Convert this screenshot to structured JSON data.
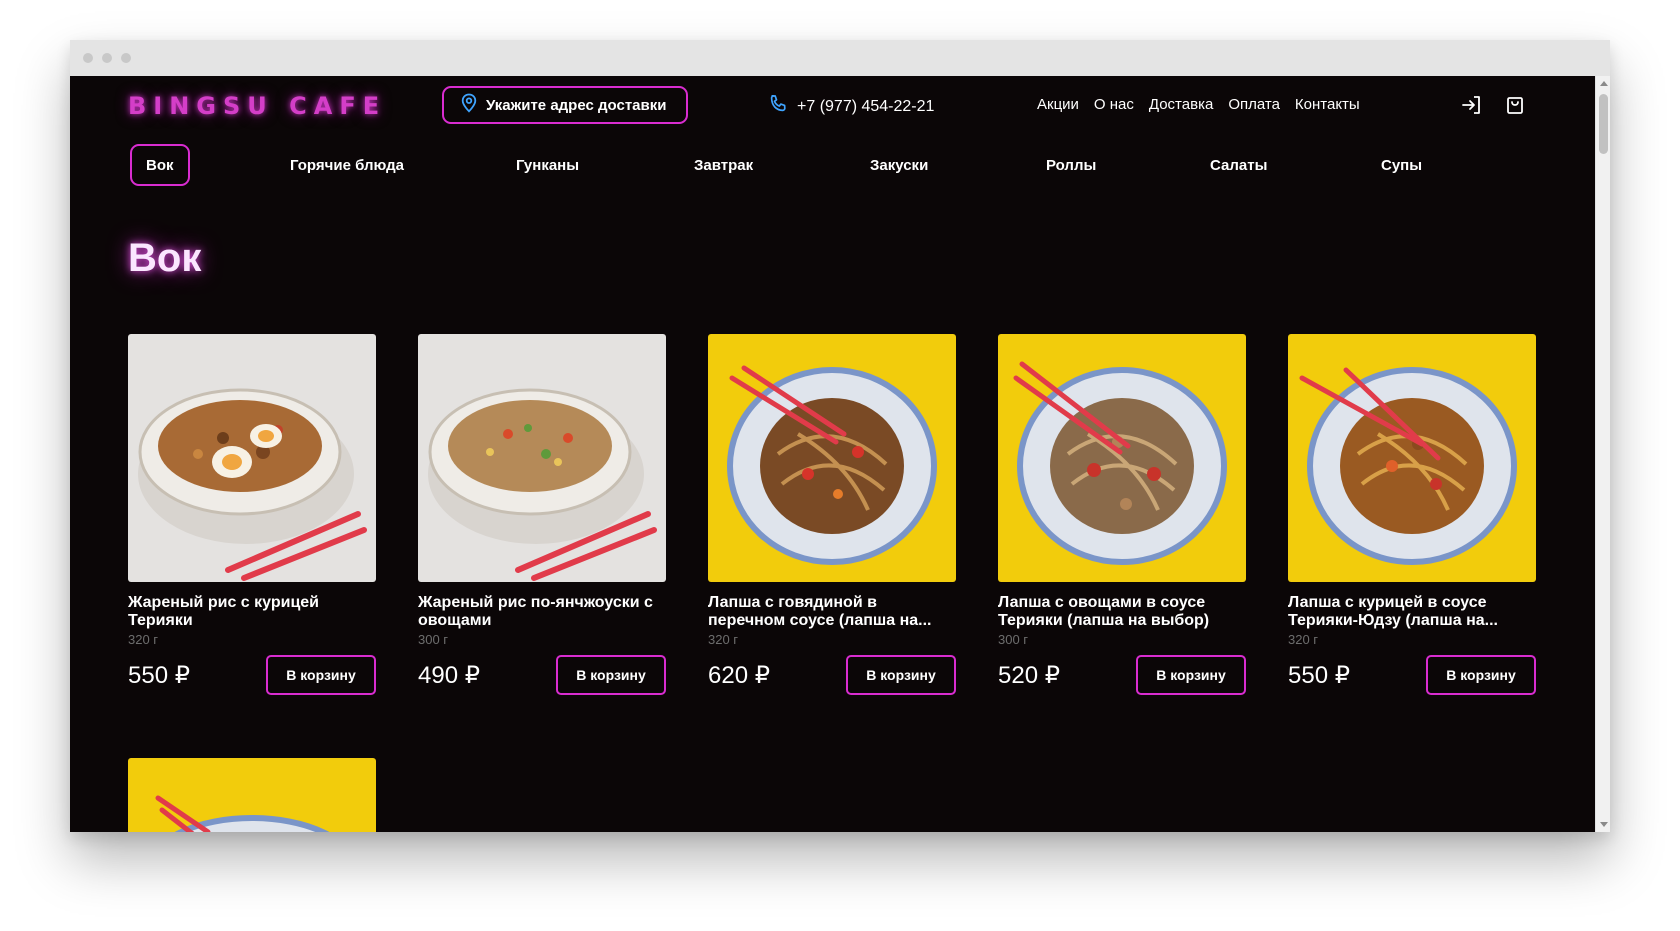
{
  "header": {
    "logo": "BINGSU CAFE",
    "address_button": "Укажите адрес доставки",
    "phone": "+7 (977) 454-22-21",
    "nav": [
      "Акции",
      "О нас",
      "Доставка",
      "Оплата",
      "Контакты"
    ],
    "icons": {
      "location": "location-pin-icon",
      "phone": "phone-icon",
      "login": "login-icon",
      "cart": "shopping-bag-icon"
    }
  },
  "categories": [
    {
      "label": "Вок",
      "active": true
    },
    {
      "label": "Горячие блюда",
      "active": false
    },
    {
      "label": "Гунканы",
      "active": false
    },
    {
      "label": "Завтрак",
      "active": false
    },
    {
      "label": "Закуски",
      "active": false
    },
    {
      "label": "Роллы",
      "active": false
    },
    {
      "label": "Салаты",
      "active": false
    },
    {
      "label": "Супы",
      "active": false
    }
  ],
  "section": {
    "title": "Вок"
  },
  "products": [
    {
      "name": "Жареный рис с курицей Терияки",
      "weight": "320 г",
      "price": "550 ₽",
      "button": "В корзину",
      "image": "bowl-rice-chicken-egg"
    },
    {
      "name": "Жареный рис по-янчжоуски с овощами",
      "weight": "300 г",
      "price": "490 ₽",
      "button": "В корзину",
      "image": "bowl-rice-vegetables"
    },
    {
      "name": "Лапша с говядиной в перечном соусе (лапша на...",
      "weight": "320 г",
      "price": "620 ₽",
      "button": "В корзину",
      "image": "noodles-beef-yellow"
    },
    {
      "name": "Лапша с овощами в соусе Терияки (лапша на выбор)",
      "weight": "300 г",
      "price": "520 ₽",
      "button": "В корзину",
      "image": "noodles-vegetables-yellow"
    },
    {
      "name": "Лапша с курицей в соусе Терияки-Юдзу (лапша на...",
      "weight": "320 г",
      "price": "550 ₽",
      "button": "В корзину",
      "image": "noodles-chicken-yellow"
    }
  ],
  "colors": {
    "accent": "#d92cd0",
    "background": "#0b0607",
    "yellow": "#f2cc0c",
    "light_bg": "#e4e2e0"
  }
}
